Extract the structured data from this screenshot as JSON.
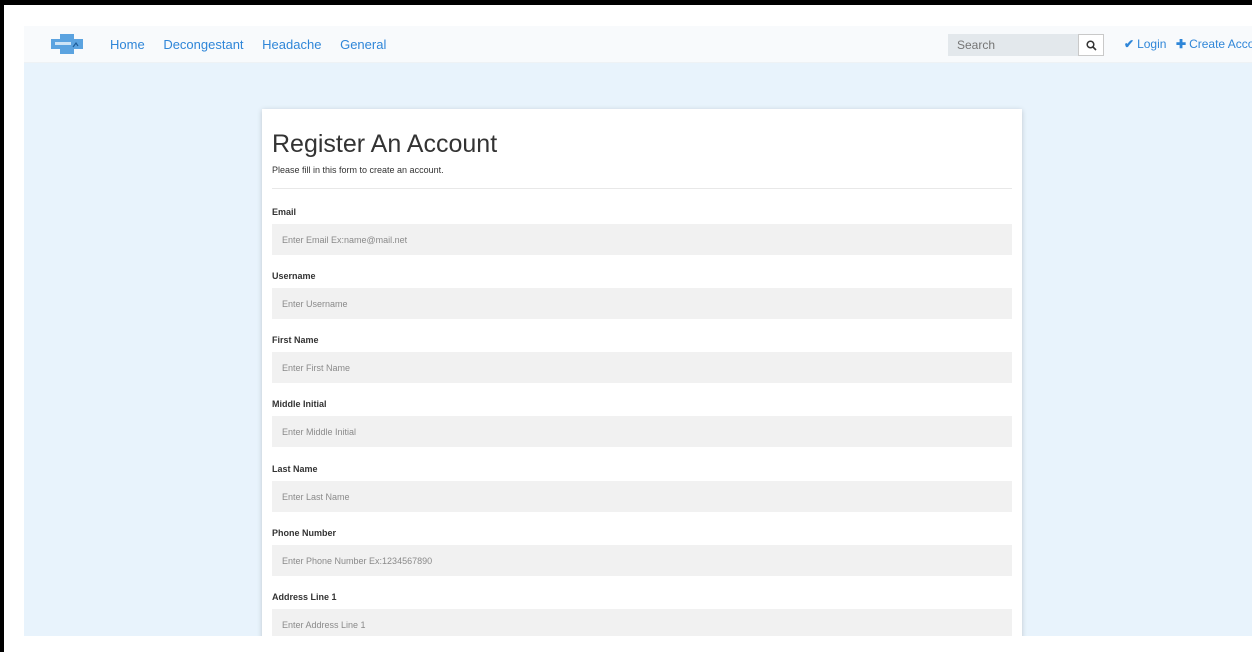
{
  "nav": {
    "links": [
      "Home",
      "Decongestant",
      "Headache",
      "General"
    ],
    "search_placeholder": "Search",
    "login_label": "Login",
    "create_account_label": "Create Account"
  },
  "form": {
    "title": "Register An Account",
    "subtitle": "Please fill in this form to create an account.",
    "fields": [
      {
        "label": "Email",
        "placeholder": "Enter Email Ex:name@mail.net"
      },
      {
        "label": "Username",
        "placeholder": "Enter Username"
      },
      {
        "label": "First Name",
        "placeholder": "Enter First Name"
      },
      {
        "label": "Middle Initial",
        "placeholder": "Enter Middle Initial"
      },
      {
        "label": "Last Name",
        "placeholder": "Enter Last Name"
      },
      {
        "label": "Phone Number",
        "placeholder": "Enter Phone Number Ex:1234567890"
      },
      {
        "label": "Address Line 1",
        "placeholder": "Enter Address Line 1"
      }
    ]
  },
  "colors": {
    "accent": "#2f86d8",
    "page_background": "#e8f3fc",
    "input_background": "#f1f1f1"
  }
}
